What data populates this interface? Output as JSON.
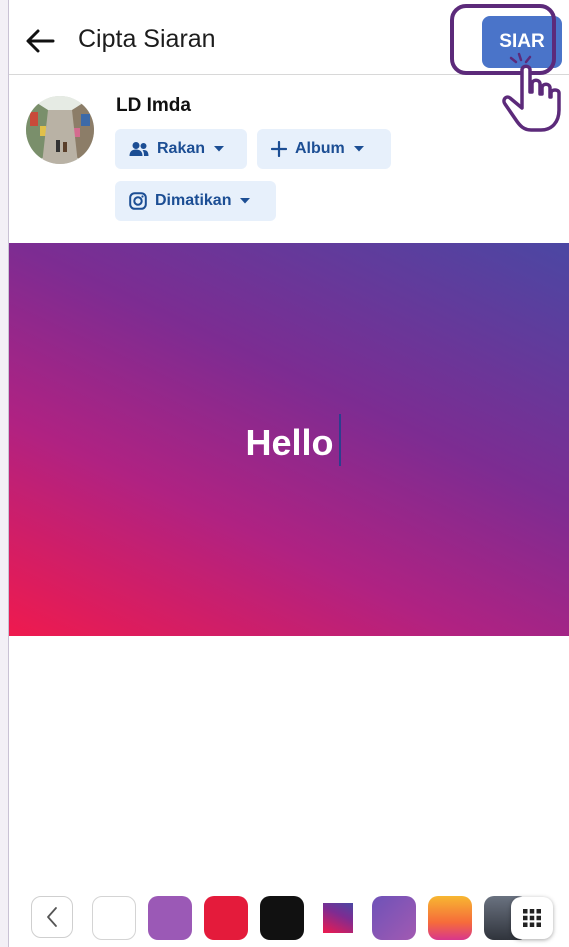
{
  "header": {
    "title": "Cipta Siaran",
    "post_label": "SIAR"
  },
  "profile": {
    "name": "LD Imda",
    "audience_label": "Rakan",
    "album_label": "Album",
    "instagram_label": "Dimatikan"
  },
  "canvas": {
    "text": "Hello"
  },
  "colors": {
    "accent": "#4a74c9",
    "highlight": "#5c2a7a",
    "chip_bg": "#e7f0fb",
    "chip_text": "#1c4e94"
  },
  "icons": [
    "back-arrow-icon",
    "friends-icon",
    "plus-icon",
    "caret-down-icon",
    "instagram-icon",
    "pointer-hand-icon",
    "chevron-left-icon",
    "grid-icon"
  ],
  "palette": [
    "white",
    "purple",
    "red",
    "black",
    "gradient-square",
    "violet",
    "orange-gradient",
    "slate"
  ]
}
